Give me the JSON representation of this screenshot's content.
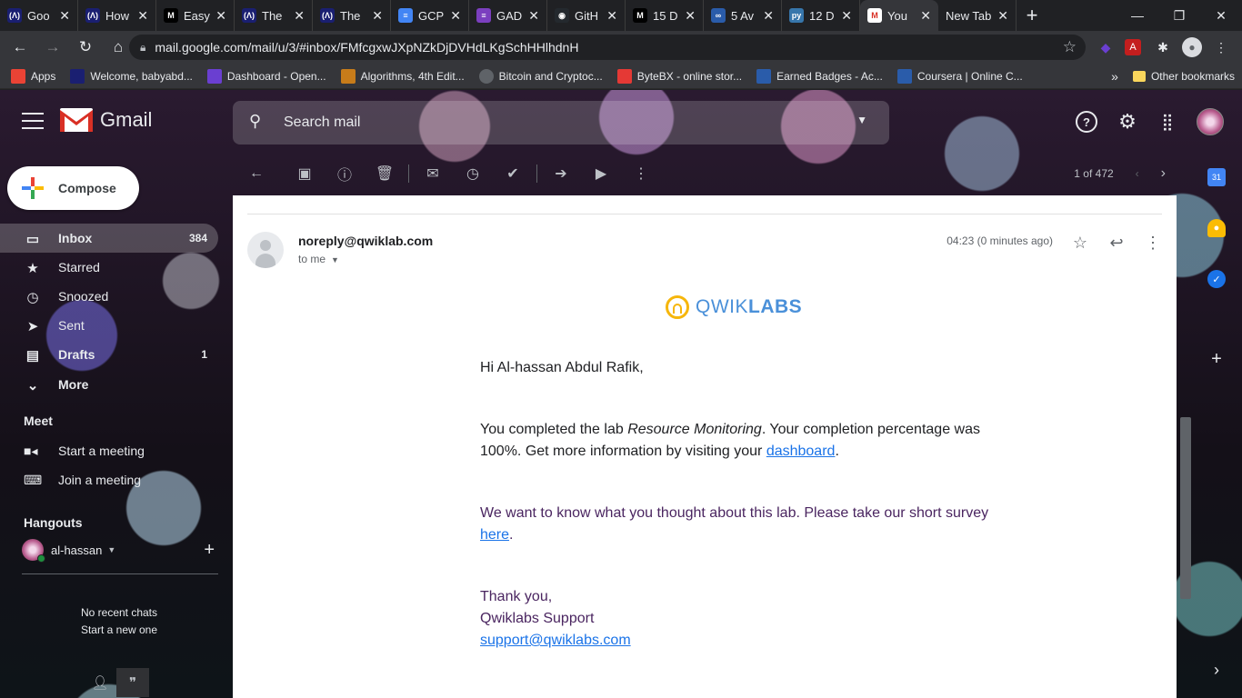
{
  "browser": {
    "tabs": [
      {
        "label": "Goo",
        "fav": "(Λ)",
        "color": "#1a1f71"
      },
      {
        "label": "How",
        "fav": "(Λ)",
        "color": "#1a1f71"
      },
      {
        "label": "Easy",
        "fav": "M",
        "color": "#000000"
      },
      {
        "label": "The",
        "fav": "(Λ)",
        "color": "#1a1f71"
      },
      {
        "label": "The",
        "fav": "(Λ)",
        "color": "#1a1f71"
      },
      {
        "label": "GCP",
        "fav": "≡",
        "color": "#4285f4"
      },
      {
        "label": "GAD",
        "fav": "≡",
        "color": "#7b3fbf"
      },
      {
        "label": "GitH",
        "fav": "◉",
        "color": "#24292e"
      },
      {
        "label": "15 D",
        "fav": "M",
        "color": "#000000"
      },
      {
        "label": "5 Av",
        "fav": "∞",
        "color": "#2a5caa"
      },
      {
        "label": "12 D",
        "fav": "py",
        "color": "#3776ab"
      },
      {
        "label": "You",
        "fav": "M",
        "color": "#ffffff"
      },
      {
        "label": "New Tab",
        "fav": "",
        "color": ""
      }
    ],
    "url": "mail.google.com/mail/u/3/#inbox/FMfcgxwJXpNZkDjDVHdLKgSchHHlhdnH",
    "bookmarks": [
      {
        "label": "Apps",
        "icon": "apps-icon"
      },
      {
        "label": "Welcome, babyabd...",
        "icon": "andela-icon"
      },
      {
        "label": "Dashboard - Open...",
        "icon": "openclassrooms-icon"
      },
      {
        "label": "Algorithms, 4th Edit...",
        "icon": "algorithms-icon"
      },
      {
        "label": "Bitcoin and Cryptoc...",
        "icon": "globe-icon"
      },
      {
        "label": "ByteBX - online stor...",
        "icon": "bytebx-icon"
      },
      {
        "label": "Earned Badges - Ac...",
        "icon": "credly-icon"
      },
      {
        "label": "Coursera | Online C...",
        "icon": "coursera-icon"
      }
    ],
    "other_bookmarks": "Other bookmarks",
    "more_bookmarks": "»"
  },
  "gmail": {
    "brand": "Gmail",
    "search_placeholder": "Search mail",
    "compose": "Compose",
    "nav": [
      {
        "label": "Inbox",
        "count": "384",
        "icon": "inbox-icon",
        "glyph": "▭"
      },
      {
        "label": "Starred",
        "count": "",
        "icon": "star-icon",
        "glyph": "★"
      },
      {
        "label": "Snoozed",
        "count": "",
        "icon": "clock-icon",
        "glyph": "◷"
      },
      {
        "label": "Sent",
        "count": "",
        "icon": "send-icon",
        "glyph": "➤"
      },
      {
        "label": "Drafts",
        "count": "1",
        "icon": "draft-icon",
        "glyph": "▤"
      },
      {
        "label": "More",
        "count": "",
        "icon": "chevron-down-icon",
        "glyph": "⌄"
      }
    ],
    "meet": {
      "heading": "Meet",
      "start": "Start a meeting",
      "join": "Join a meeting"
    },
    "hangouts": {
      "heading": "Hangouts",
      "user": "al-hassan",
      "no_chats": "No recent chats",
      "start_new": "Start a new one"
    },
    "pager": "1 of 472"
  },
  "message": {
    "sender": "noreply@qwiklab.com",
    "to": "to me",
    "time": "04:23 (0 minutes ago)",
    "logo_light": "QWIK",
    "logo_bold": "LABS",
    "greeting": "Hi Al-hassan Abdul Rafik,",
    "p1_a": "You completed the lab ",
    "p1_lab": "Resource Monitoring",
    "p1_b": ". Your completion percentage was 100%. Get more information by visiting your ",
    "p1_link": "dashboard",
    "p1_end": ".",
    "p2_a": "We want to know what you thought about this lab. Please take our short survey ",
    "p2_link": "here",
    "p2_end": ".",
    "signoff": "Thank you,",
    "signature": "Qwiklabs Support",
    "support_email": "support@qwiklabs.com"
  }
}
